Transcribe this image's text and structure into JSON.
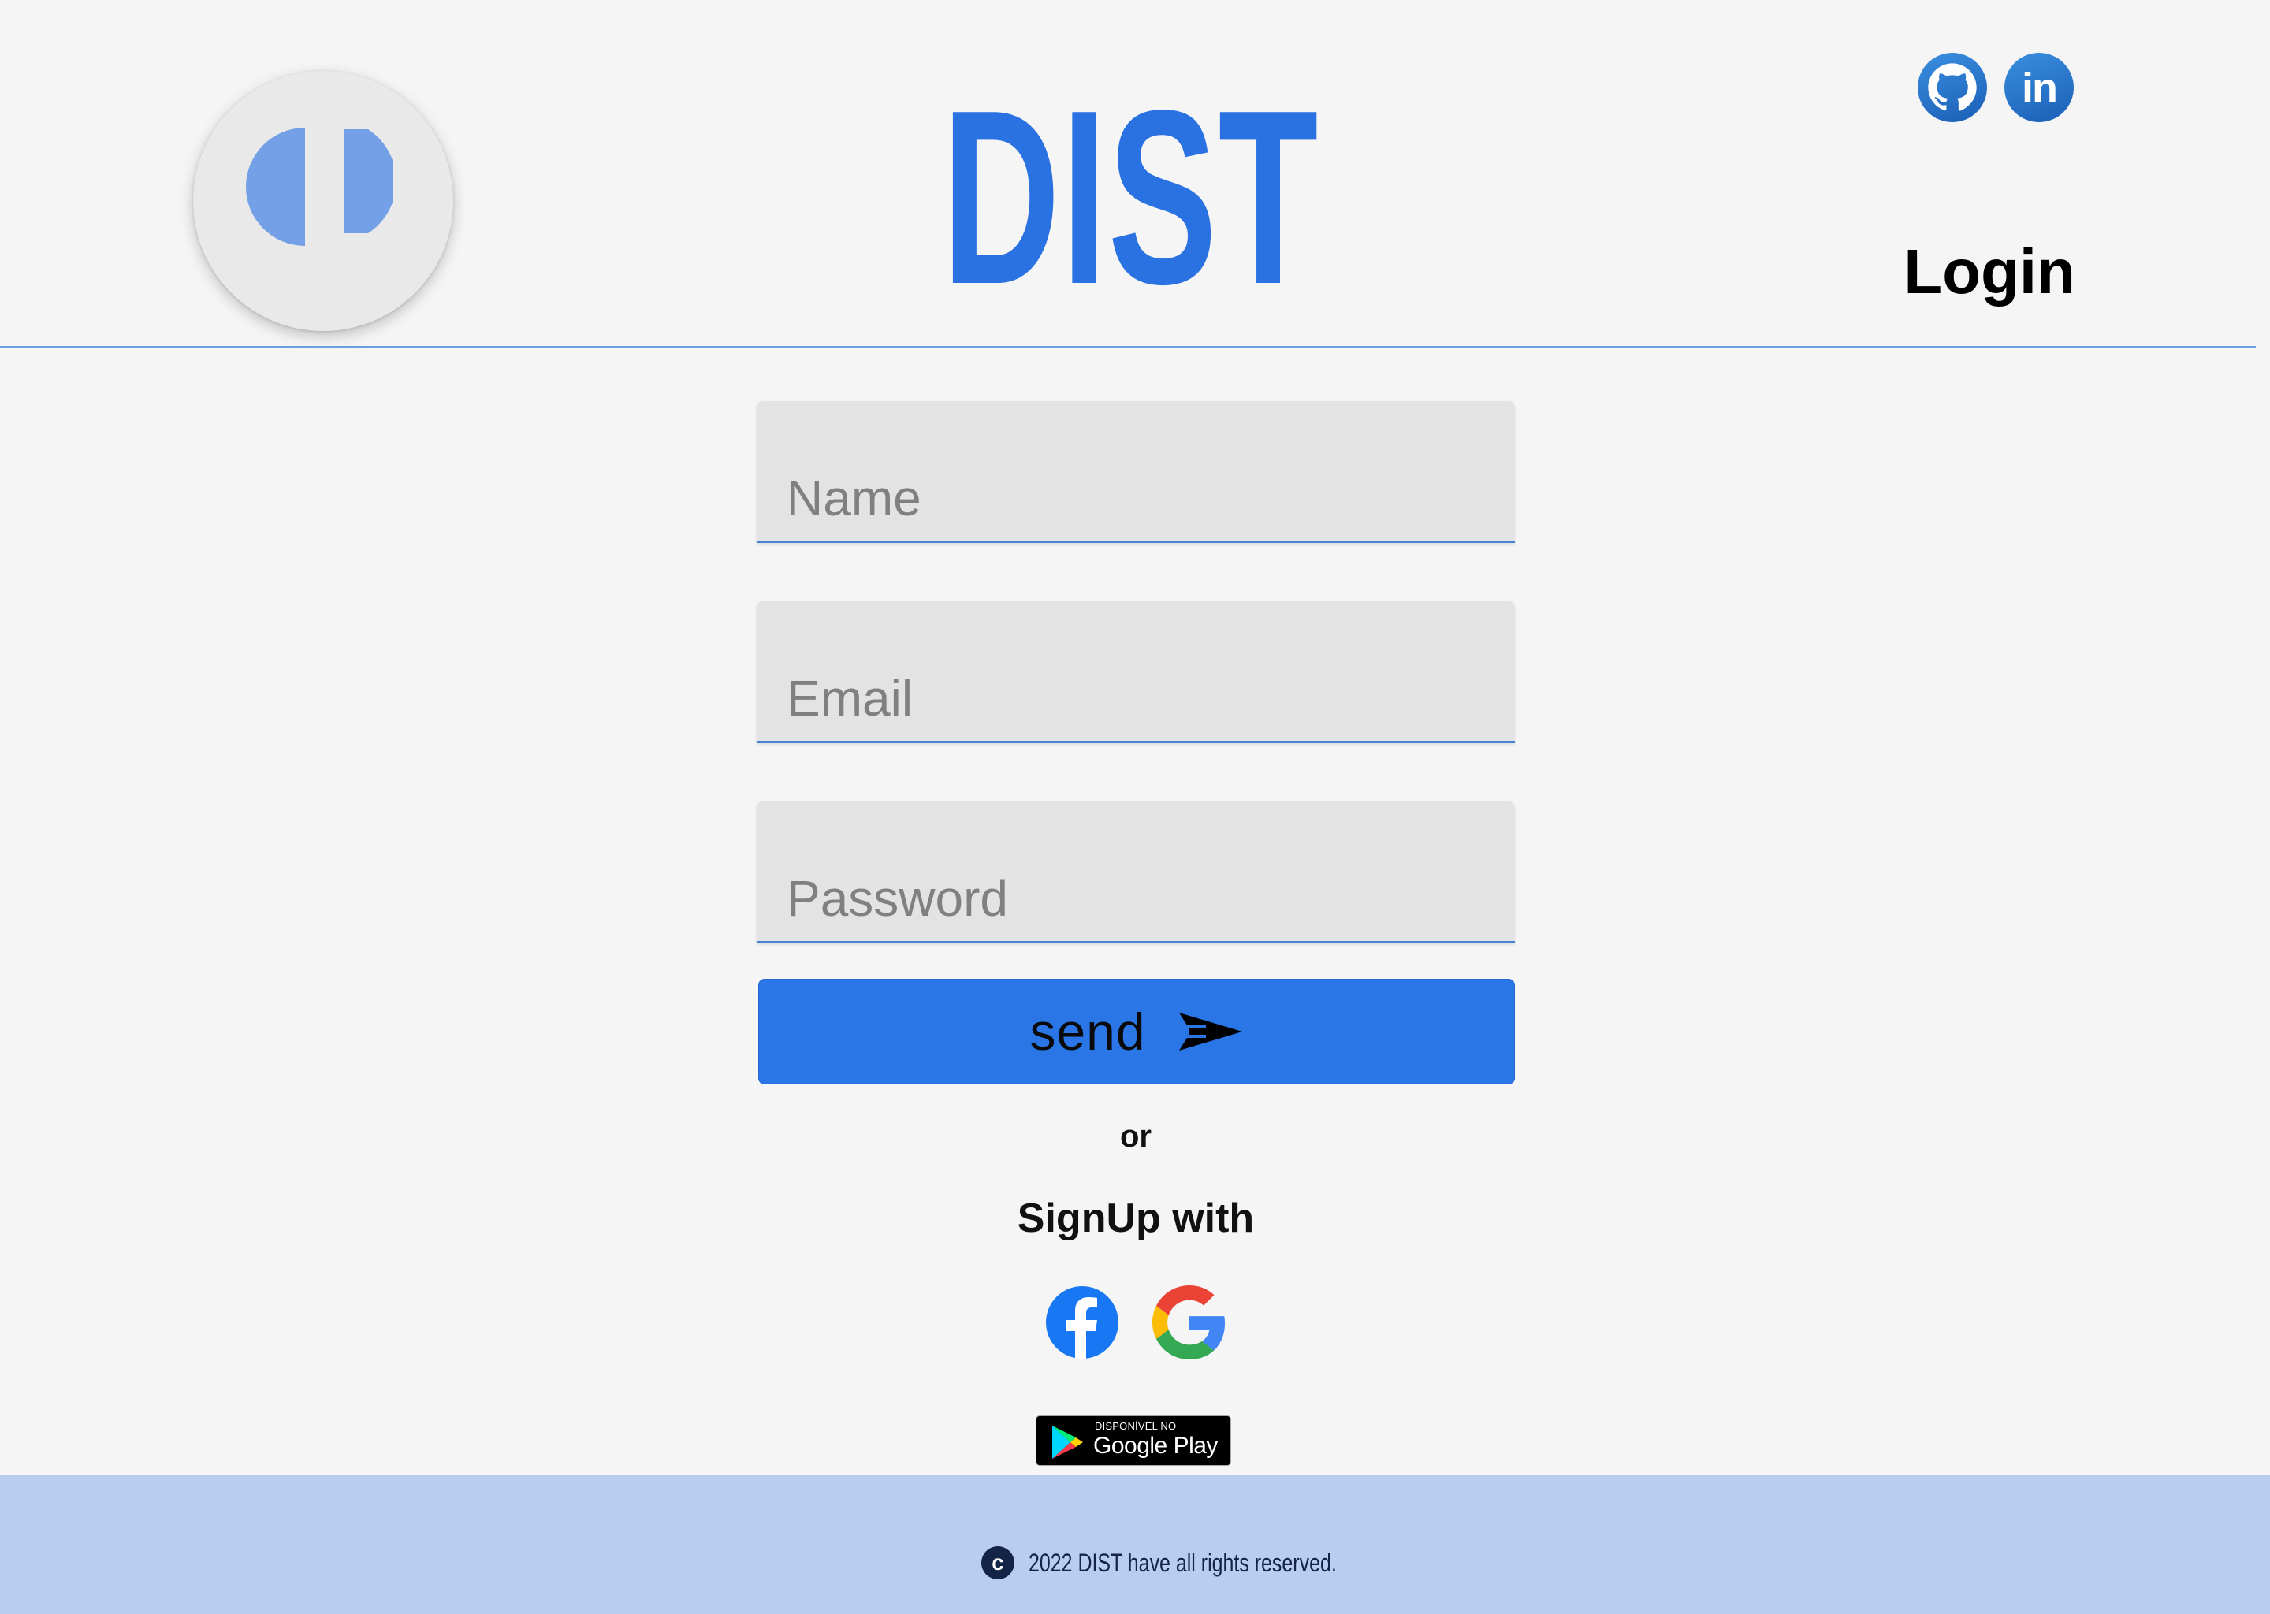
{
  "header": {
    "brand": "DIST",
    "login_label": "Login",
    "logo_icon": "dist-logo-icon",
    "social": [
      {
        "name": "github",
        "icon": "github-icon"
      },
      {
        "name": "linkedin",
        "icon": "linkedin-icon",
        "glyph": "in"
      }
    ]
  },
  "form": {
    "name": {
      "placeholder": "Name",
      "value": ""
    },
    "email": {
      "placeholder": "Email",
      "value": ""
    },
    "password": {
      "placeholder": "Password",
      "value": ""
    },
    "send_label": "send",
    "send_icon": "send-arrow-icon",
    "or_label": "or",
    "signup_label": "SignUp with",
    "signup_providers": [
      {
        "name": "facebook",
        "icon": "facebook-icon"
      },
      {
        "name": "google",
        "icon": "google-icon"
      }
    ],
    "store_badge": {
      "small_text": "DISPONÍVEL NO",
      "big_text": "Google Play",
      "icon": "google-play-icon"
    }
  },
  "footer": {
    "copyright_symbol": "c",
    "text": "2022 DIST have all rights reserved."
  },
  "colors": {
    "accent": "#2a76e6",
    "background": "#f5f5f5",
    "field_background": "#e3e3e3",
    "footer_background": "#b8cdef",
    "footer_text": "#132446"
  }
}
